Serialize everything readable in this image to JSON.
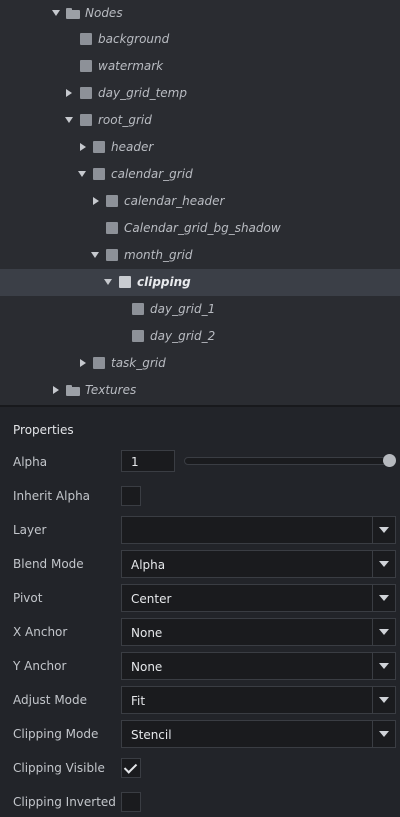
{
  "outline": {
    "items": [
      {
        "label": "Nodes",
        "icon": "folder-icon",
        "expander": "down"
      },
      {
        "label": "background",
        "icon": "node-icon",
        "expander": "none"
      },
      {
        "label": "watermark",
        "icon": "node-icon",
        "expander": "none"
      },
      {
        "label": "day_grid_temp",
        "icon": "node-icon",
        "expander": "right"
      },
      {
        "label": "root_grid",
        "icon": "node-icon",
        "expander": "down"
      },
      {
        "label": "header",
        "icon": "node-icon",
        "expander": "right"
      },
      {
        "label": "calendar_grid",
        "icon": "node-icon",
        "expander": "down"
      },
      {
        "label": "calendar_header",
        "icon": "node-icon",
        "expander": "right"
      },
      {
        "label": "Calendar_grid_bg_shadow",
        "icon": "node-icon",
        "expander": "none"
      },
      {
        "label": "month_grid",
        "icon": "node-icon",
        "expander": "down"
      },
      {
        "label": "clipping",
        "icon": "node-icon",
        "expander": "down",
        "selected": true
      },
      {
        "label": "day_grid_1",
        "icon": "node-icon",
        "expander": "none"
      },
      {
        "label": "day_grid_2",
        "icon": "node-icon",
        "expander": "none"
      },
      {
        "label": "task_grid",
        "icon": "node-icon",
        "expander": "right"
      },
      {
        "label": "Textures",
        "icon": "folder-icon",
        "expander": "right"
      }
    ]
  },
  "properties": {
    "title": "Properties",
    "alpha": {
      "label": "Alpha",
      "value": "1",
      "slider_level": 1.0
    },
    "inherit_alpha": {
      "label": "Inherit Alpha",
      "checked": false
    },
    "layer": {
      "label": "Layer",
      "value": ""
    },
    "blend_mode": {
      "label": "Blend Mode",
      "value": "Alpha"
    },
    "pivot": {
      "label": "Pivot",
      "value": "Center"
    },
    "x_anchor": {
      "label": "X Anchor",
      "value": "None"
    },
    "y_anchor": {
      "label": "Y Anchor",
      "value": "None"
    },
    "adjust_mode": {
      "label": "Adjust Mode",
      "value": "Fit"
    },
    "clipping_mode": {
      "label": "Clipping Mode",
      "value": "Stencil"
    },
    "clipping_visible": {
      "label": "Clipping Visible",
      "checked": true
    },
    "clipping_inverted": {
      "label": "Clipping Inverted",
      "checked": false
    }
  },
  "colors": {
    "panel_bg": "#222429",
    "outline_bg": "#2a2c31",
    "selection_bg": "#3b3f47",
    "field_bg": "#1a1b1e"
  }
}
